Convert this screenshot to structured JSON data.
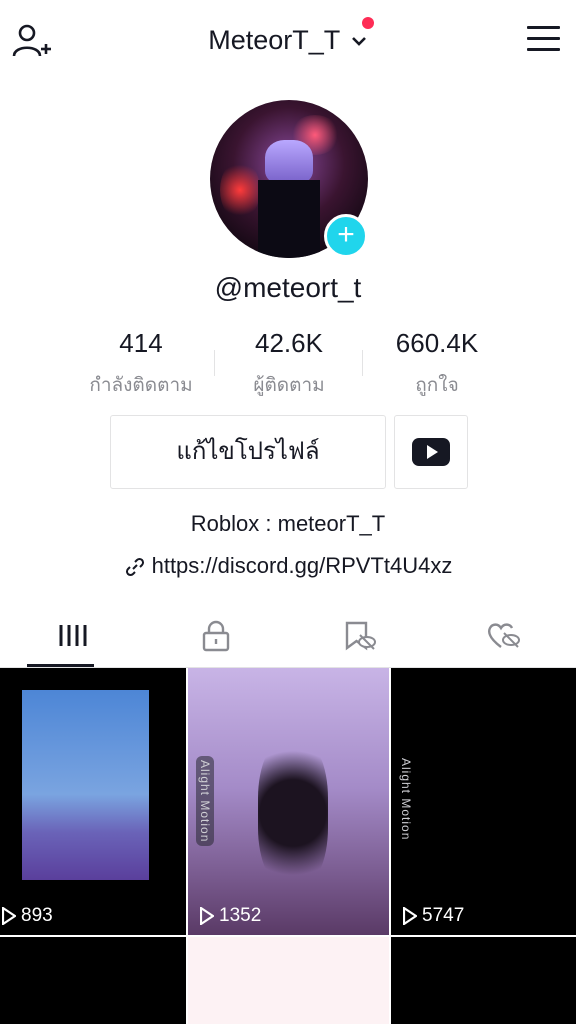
{
  "header": {
    "username": "MeteorT_T"
  },
  "profile": {
    "handle": "@meteort_t",
    "bio": "Roblox : meteorT_T",
    "link": "https://discord.gg/RPVTt4U4xz"
  },
  "stats": [
    {
      "value": "414",
      "label": "กำลังติดตาม"
    },
    {
      "value": "42.6K",
      "label": "ผู้ติดตาม"
    },
    {
      "value": "660.4K",
      "label": "ถูกใจ"
    }
  ],
  "buttons": {
    "edit_profile": "แก้ไขโปรไฟล์"
  },
  "tabs": [
    {
      "icon": "grid-videos-icon"
    },
    {
      "icon": "lock-icon"
    },
    {
      "icon": "bookmark-eye-off-icon"
    },
    {
      "icon": "heart-eye-off-icon"
    }
  ],
  "videos": [
    {
      "views": "893",
      "label": ""
    },
    {
      "views": "1352",
      "label": "Alight Motion"
    },
    {
      "views": "5747",
      "label": "Alight Motion"
    }
  ],
  "colors": {
    "accent_red": "#fe2c55",
    "badge_cyan": "#20d5ec",
    "text_primary": "#161823",
    "text_secondary": "#8a8b91"
  }
}
